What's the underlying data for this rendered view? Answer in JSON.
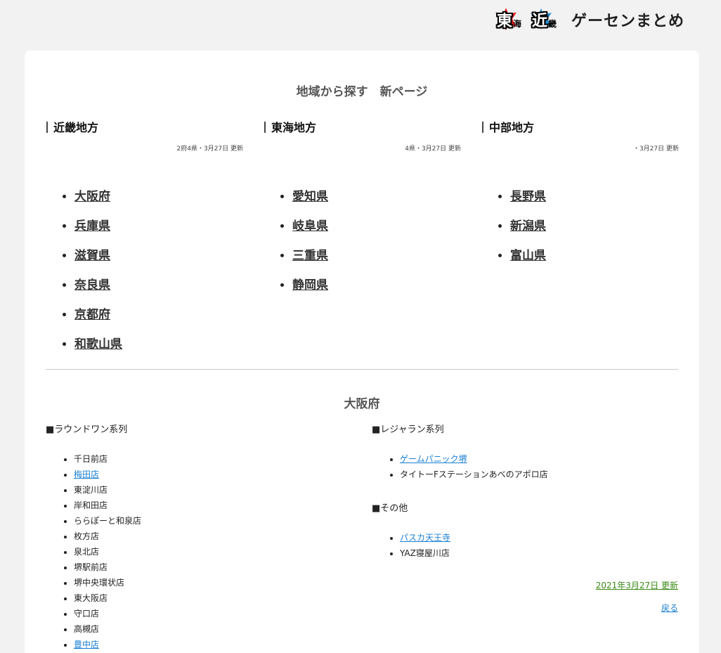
{
  "logo": {
    "badge1": {
      "big": "東",
      "small": "海"
    },
    "badge2": {
      "big": "近",
      "small": "畿"
    },
    "text": "ゲーセンまとめ"
  },
  "region_section": {
    "title": "地域から探す　新ページ",
    "regions": [
      {
        "name": "近畿地方",
        "meta": "2府4県・3月27日 更新",
        "prefs": [
          "大阪府",
          "兵庫県",
          "滋賀県",
          "奈良県",
          "京都府",
          "和歌山県"
        ]
      },
      {
        "name": "東海地方",
        "meta": "4県・3月27日 更新",
        "prefs": [
          "愛知県",
          "岐阜県",
          "三重県",
          "静岡県"
        ]
      },
      {
        "name": "中部地方",
        "meta": "・3月27日 更新",
        "prefs": [
          "長野県",
          "新潟県",
          "富山県"
        ]
      }
    ]
  },
  "osaka": {
    "title": "大阪府",
    "round1": {
      "title": "■ラウンドワン系列",
      "shops": [
        "千日前店",
        "梅田店",
        "東淀川店",
        "岸和田店",
        "ららぽーと和泉店",
        "枚方店",
        "泉北店",
        "堺駅前店",
        "堺中央環状店",
        "東大阪店",
        "守口店",
        "高槻店",
        "豊中店"
      ],
      "linked": [
        1,
        12
      ]
    },
    "leisureland": {
      "title": "■レジャラン系列",
      "shops": [
        "ゲームパニック堺",
        "タイトーFステーションあべのアポロ店"
      ],
      "linked": [
        0
      ]
    },
    "other": {
      "title": "■その他",
      "shops": [
        "パスカ天王寺",
        "YAZ寝屋川店"
      ],
      "linked": [
        0
      ]
    },
    "updated": "2021年3月27日 更新",
    "back": "戻る"
  }
}
